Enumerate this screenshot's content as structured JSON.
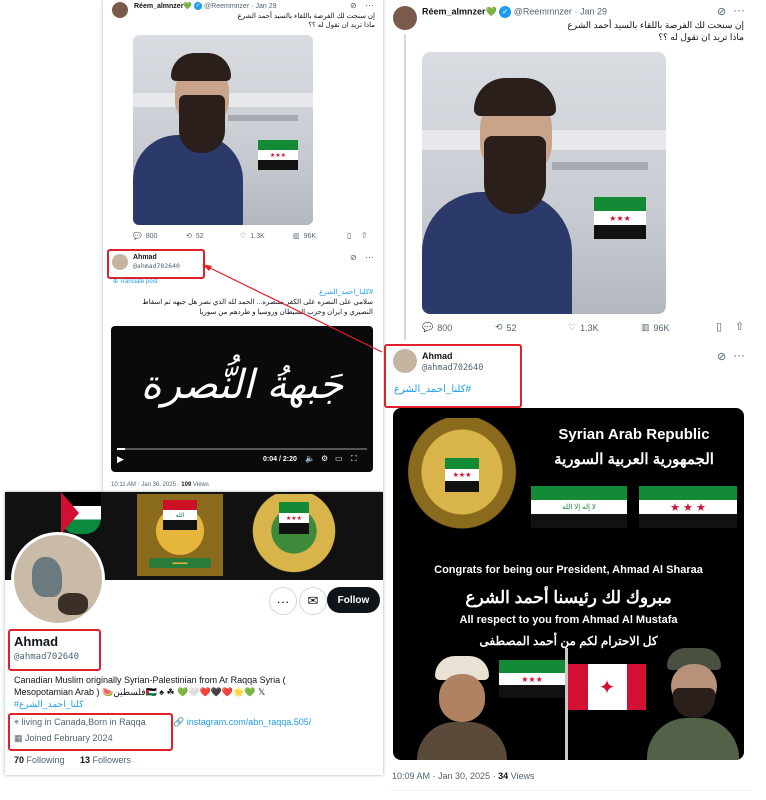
{
  "left_tweet": {
    "author_name": "Réem_almnzer💚",
    "author_handle": "@Reemmnzer",
    "date": "· Jan 29",
    "text_line1": "إن سنحت لك الفرصة باللقاء بالسيد أحمد الشرع",
    "text_line2": "ماذا تريد ان تقول له ؟؟",
    "replies": "800",
    "retweets": "52",
    "likes": "1.3K",
    "views": "96K"
  },
  "left_quote": {
    "name": "Ahmad",
    "handle": "@ahmad702640",
    "translate": "Translate post",
    "hashtag": "#كلنا_احمد_الشرع",
    "body_line1": "سلامي على النصره على الكفر منتصره... الحمد لله الذي نصر هل جبهه تم اسقاط",
    "body_line2": "النصيري و ايران وحزب الشيطان وروسيا و طردهم من سوريا",
    "video_title": "جَبهةُ النُّصرة",
    "video_time": "0:04 / 2:20",
    "footer_time": "10:11 AM · Jan 30, 2025 ·",
    "footer_views_num": "109",
    "footer_views_label": "Views"
  },
  "profile": {
    "follow_label": "Follow",
    "name": "Ahmad",
    "handle": "@ahmad702640",
    "bio_line1": "Canadian Muslim originally Syrian-Palestinian from Ar Raqqa Syria (",
    "bio_line2": "Mesopotamian Arab ) 🍉فلسطين🇵🇸 ♠ ☘ 💚🤍❤️🖤❤️🌟💚 𝕏",
    "bio_hashtag": "#كلنا_احمد_الشرع",
    "location": "living in Canada,Born in Raqqa",
    "website": "instagram.com/abn_raqqa.505/",
    "joined": "Joined February 2024",
    "following_num": "70",
    "following_label": "Following",
    "followers_num": "13",
    "followers_label": "Followers"
  },
  "right_tweet": {
    "author_name": "Réem_almnzer💚",
    "author_handle": "@Reemmnzer",
    "date": "· Jan 29",
    "text_line1": "إن سنحت لك الفرصة باللقاء بالسيد أحمد الشرع",
    "text_line2": "ماذا تريد ان تقول له ؟؟",
    "replies": "800",
    "retweets": "52",
    "likes": "1.3K",
    "views": "96K"
  },
  "right_reply": {
    "name": "Ahmad",
    "handle": "@ahmad702640",
    "hashtag": "#كلنا_احمد_الشرع",
    "poster_en_title": "Syrian Arab Republic",
    "poster_ar_title": "الجمهورية العربية السورية",
    "poster_congrats": "Congrats for being our President, Ahmad Al Sharaa",
    "poster_ar_congrats": "مبروك لك رئيسنا أحمد الشرع",
    "poster_respect": "All respect to you from Ahmad Al Mustafa",
    "poster_ar_respect": "كل الاحترام لكم من أحمد المصطفى",
    "footer_time": "10:09 AM · Jan 30, 2025 ·",
    "footer_views_num": "34",
    "footer_views_label": "Views"
  },
  "colors": {
    "accent": "#1d9bf0",
    "annotation": "#e0202a",
    "syria_green": "#138a36",
    "syria_red": "#d21034"
  }
}
